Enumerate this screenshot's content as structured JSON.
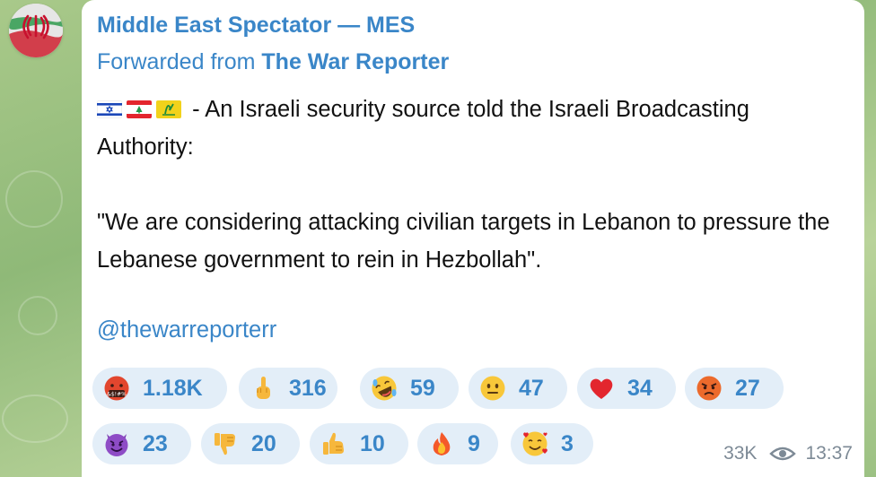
{
  "channel": {
    "name": "Middle East Spectator — MES",
    "forwarded_prefix": "Forwarded from",
    "forwarded_source": "The War Reporter"
  },
  "message": {
    "flags": [
      "israel-flag",
      "lebanon-flag",
      "hezbollah-flag"
    ],
    "text": " - An Israeli security source told the Israeli Broadcasting Authority:\n\n\"We are considering attacking civilian targets in Lebanon to pressure the Lebanese government to rein in Hezbollah\".",
    "mention": "@thewarreporterr"
  },
  "reactions": [
    {
      "emoji": "face-with-symbols-on-mouth",
      "count": "1.18K"
    },
    {
      "emoji": "middle-finger",
      "count": "316"
    },
    {
      "emoji": "rolling-on-floor-laughing",
      "count": "59"
    },
    {
      "emoji": "neutral-face",
      "count": "47"
    },
    {
      "emoji": "red-heart",
      "count": "34"
    },
    {
      "emoji": "angry-face",
      "count": "27"
    },
    {
      "emoji": "smiling-face-with-horns",
      "count": "23"
    },
    {
      "emoji": "thumbs-down",
      "count": "20"
    },
    {
      "emoji": "thumbs-up",
      "count": "10"
    },
    {
      "emoji": "fire",
      "count": "9"
    },
    {
      "emoji": "smiling-face-with-hearts",
      "count": "3"
    }
  ],
  "footer": {
    "views": "33K",
    "time": "13:37"
  },
  "colors": {
    "accent": "#3a86c8",
    "reaction_bg": "#e3eef8",
    "meta_text": "#7d8a96",
    "wallpaper": "#a9c98a"
  }
}
